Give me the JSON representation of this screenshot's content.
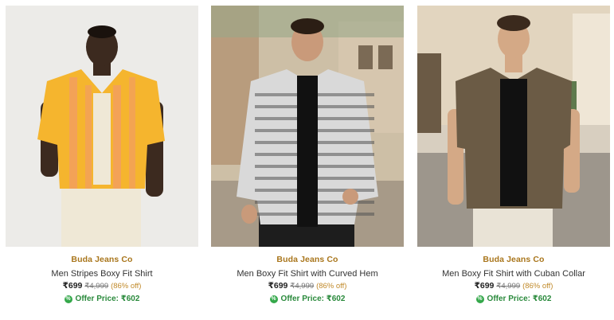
{
  "products": [
    {
      "brand": "Buda Jeans Co",
      "title": "Men Stripes Boxy Fit Shirt",
      "price": "₹699",
      "mrp": "₹4,999",
      "discount": "(86% off)",
      "offer_label": "Offer Price: ₹602",
      "colors": {
        "background": "#ecebe8",
        "shirt": "#f5b52e",
        "stripe": "#f29a6a",
        "pants": "#efe8d6",
        "skin": "#3c2a1f"
      }
    },
    {
      "brand": "Buda Jeans Co",
      "title": "Men Boxy Fit Shirt with Curved Hem",
      "price": "₹699",
      "mrp": "₹4,999",
      "discount": "(86% off)",
      "offer_label": "Offer Price: ₹602",
      "colors": {
        "background": "#c9b9a0",
        "shirt": "#d9d9d9",
        "pattern": "#555555",
        "inner": "#111111",
        "skin": "#c99a7a"
      }
    },
    {
      "brand": "Buda Jeans Co",
      "title": "Men Boxy Fit Shirt with Cuban Collar",
      "price": "₹699",
      "mrp": "₹4,999",
      "discount": "(86% off)",
      "offer_label": "Offer Price: ₹602",
      "colors": {
        "background": "#d8cfc0",
        "shirt": "#6b5b45",
        "inner": "#111111",
        "pants": "#e9e3d6",
        "skin": "#d4a986"
      }
    }
  ],
  "icons": {
    "offer": "offer-tag-icon"
  }
}
